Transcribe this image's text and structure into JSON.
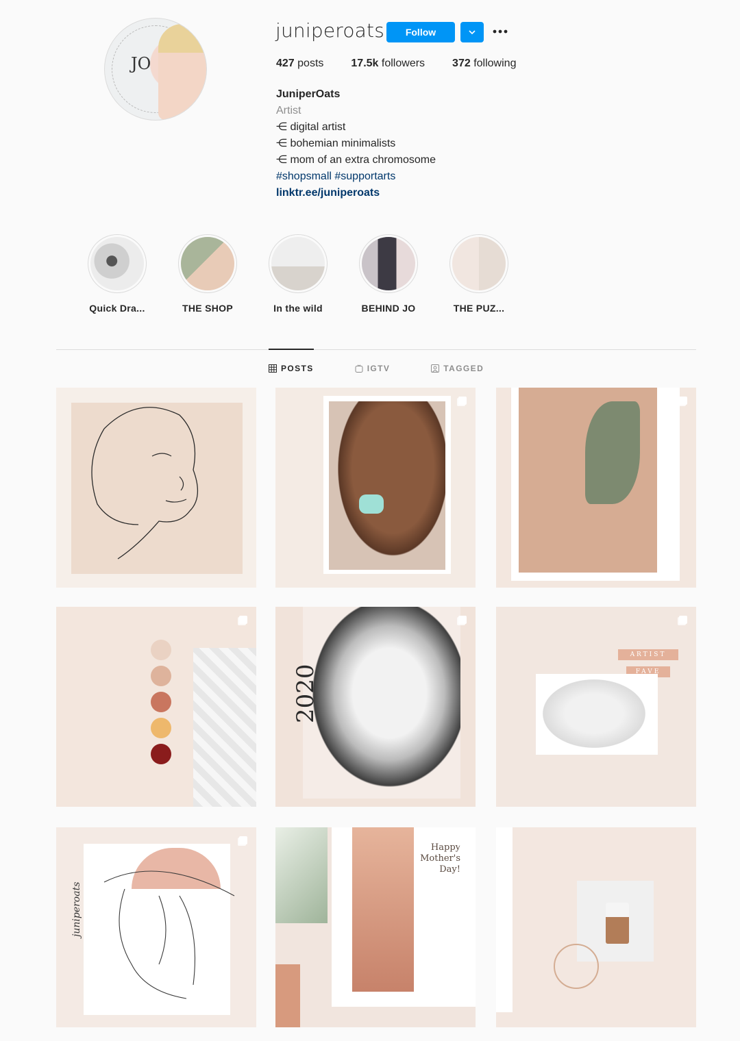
{
  "profile": {
    "username": "juniperoats",
    "follow_label": "Follow",
    "avatar_mono": "JO",
    "stats": [
      {
        "num": "427",
        "label": "posts"
      },
      {
        "num": "17.5k",
        "label": "followers"
      },
      {
        "num": "372",
        "label": "following"
      }
    ],
    "bio": {
      "name": "JuniperOats",
      "category": "Artist",
      "lines": [
        "⋲ digital artist",
        "⋲ bohemian minimalists",
        "⋲ mom of an extra chromosome"
      ],
      "tags": "#shopsmall #supportarts",
      "link": "linktr.ee/juniperoats"
    }
  },
  "highlights": [
    {
      "label": "Quick Dra..."
    },
    {
      "label": "THE SHOP"
    },
    {
      "label": "In the wild"
    },
    {
      "label": "BEHIND JO"
    },
    {
      "label": "THE PUZ..."
    }
  ],
  "tabs": [
    {
      "label": "POSTS",
      "icon": "grid-icon",
      "active": true
    },
    {
      "label": "IGTV",
      "icon": "igtv-icon",
      "active": false
    },
    {
      "label": "TAGGED",
      "icon": "tagged-icon",
      "active": false
    }
  ],
  "posts": {
    "t5_year": "2020",
    "t6_pill1": "ARTIST",
    "t6_pill2": "FAVE",
    "t7_signature": "juniperoats",
    "t8_message": [
      "Happy",
      "Mother's",
      "Day!"
    ]
  },
  "colors": {
    "accent": "#0095f6",
    "link": "#00376b",
    "swatches": [
      "#ead2c3",
      "#deb39c",
      "#c9765f",
      "#eeb86c",
      "#8a1c1c"
    ]
  }
}
